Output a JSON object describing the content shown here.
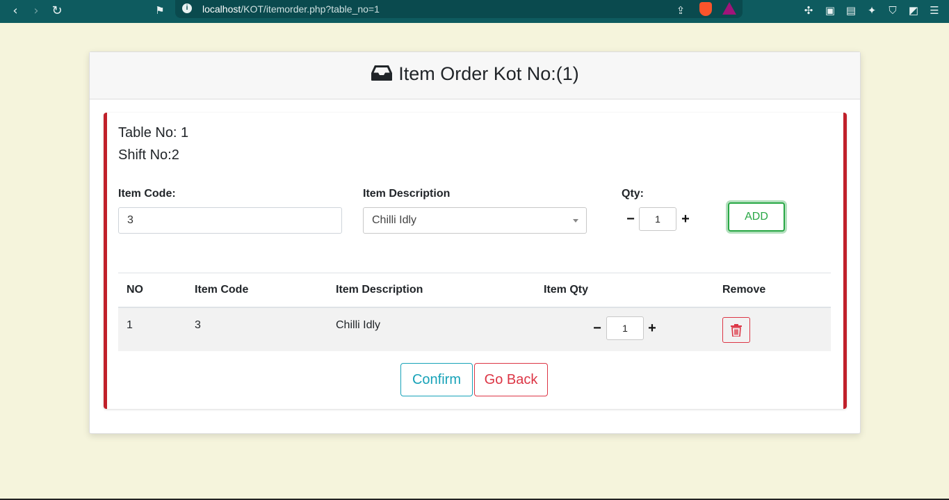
{
  "browser": {
    "url_host": "localhost",
    "url_path": "/KOT/itemorder.php?table_no=1",
    "back_icon": "‹",
    "forward_icon": "›",
    "reload_icon": "↻"
  },
  "card": {
    "title": "Item Order Kot No:(1)",
    "icon": "inbox-icon"
  },
  "meta": {
    "table_label": "Table No:  1",
    "shift_label": "Shift No:2"
  },
  "form": {
    "item_code_label": "Item Code:",
    "item_code_value": "3",
    "item_description_label": "Item Description",
    "item_description_value": "Chilli Idly",
    "qty_label": "Qty:",
    "qty_value": "1",
    "minus": "−",
    "plus": "+",
    "add_label": "ADD"
  },
  "table": {
    "headers": [
      "NO",
      "Item Code",
      "Item Description",
      "Item Qty",
      "Remove"
    ],
    "rows": [
      {
        "no": "1",
        "item_code": "3",
        "item_description": "Chilli Idly",
        "item_qty": "1"
      }
    ]
  },
  "actions": {
    "confirm_label": "Confirm",
    "go_back_label": "Go Back"
  },
  "colors": {
    "chrome": "#0e5b5f",
    "page_bg": "#f5f4dc",
    "accent_red": "#c0202a",
    "success": "#28a745",
    "info": "#17a2b8",
    "danger": "#dc3545"
  }
}
